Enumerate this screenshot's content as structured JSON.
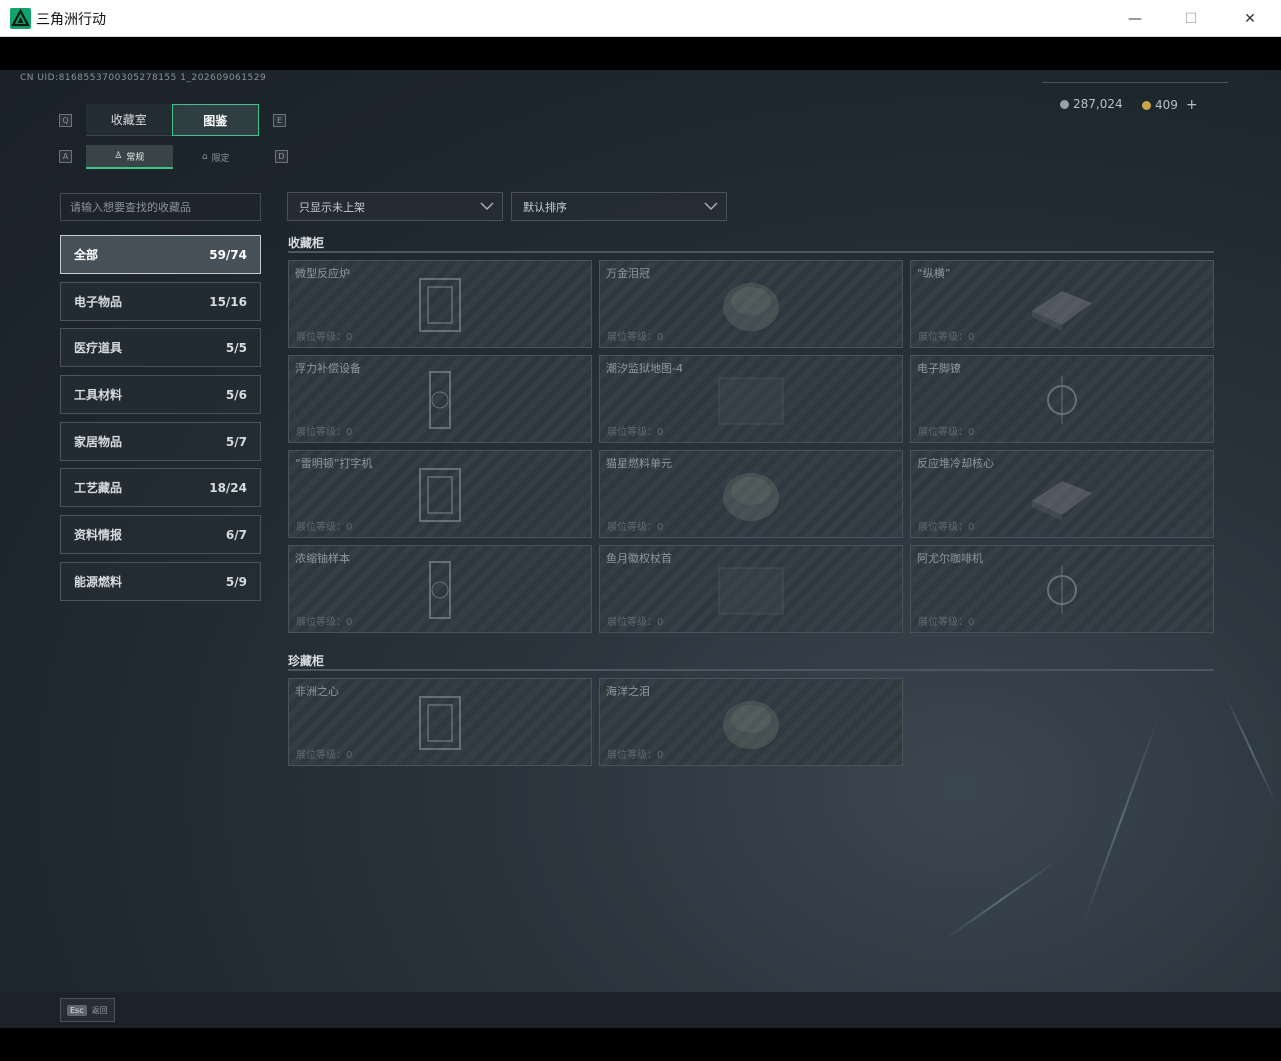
{
  "window": {
    "title": "三角洲行动",
    "minimize": "—",
    "maximize": "☐",
    "close": "✕"
  },
  "uid": "CN UID:8168553700305278155 1_202609061529",
  "currency": [
    {
      "value": "287,024",
      "color": "#9aa0a6"
    },
    {
      "value": "409",
      "color": "#c9a74a",
      "plus": "+"
    }
  ],
  "key_hints": {
    "q": "Q",
    "e": "E",
    "a": "A",
    "d": "D"
  },
  "main_tabs": [
    {
      "label": "收藏室",
      "active": false
    },
    {
      "label": "图鉴",
      "active": true
    }
  ],
  "sub_tabs": [
    {
      "label": "常规",
      "icon": "collection-icon",
      "active": true
    },
    {
      "label": "限定",
      "icon": "limited-icon",
      "active": false
    }
  ],
  "search": {
    "placeholder": "请输入想要查找的收藏品"
  },
  "categories": [
    {
      "label": "全部",
      "count": "59/74",
      "active": true
    },
    {
      "label": "电子物品",
      "count": "15/16"
    },
    {
      "label": "医疗道具",
      "count": "5/5"
    },
    {
      "label": "工具材料",
      "count": "5/6"
    },
    {
      "label": "家居物品",
      "count": "5/7"
    },
    {
      "label": "工艺藏品",
      "count": "18/24"
    },
    {
      "label": "资料情报",
      "count": "6/7"
    },
    {
      "label": "能源燃料",
      "count": "5/9"
    }
  ],
  "filters": {
    "display": "只显示未上架",
    "sort": "默认排序"
  },
  "sections": {
    "cabinet": {
      "title": "收藏柜",
      "items": [
        {
          "name": "微型反应炉",
          "level": "展位等级：0",
          "icon": "reactor-icon"
        },
        {
          "name": "万金泪冠",
          "level": "展位等级：0",
          "icon": "crown-icon"
        },
        {
          "name": "“纵横”",
          "level": "展位等级：0",
          "icon": "board-icon"
        },
        {
          "name": "浮力补偿设备",
          "level": "展位等级：0",
          "icon": "buoyancy-icon"
        },
        {
          "name": "潮汐监狱地图-4",
          "level": "展位等级：0",
          "icon": "map-icon"
        },
        {
          "name": "电子脚镣",
          "level": "展位等级：0",
          "icon": "shackle-icon"
        },
        {
          "name": "“雷明顿”打字机",
          "level": "展位等级：0",
          "icon": "typewriter-icon"
        },
        {
          "name": "猫星燃料单元",
          "level": "展位等级：0",
          "icon": "fuel-cell-icon"
        },
        {
          "name": "反应堆冷却核心",
          "level": "展位等级：0",
          "icon": "core-icon"
        },
        {
          "name": "浓缩铀样本",
          "level": "展位等级：0",
          "icon": "uranium-icon"
        },
        {
          "name": "鱼月徽权杖首",
          "level": "展位等级：0",
          "icon": "scepter-icon"
        },
        {
          "name": "阿尤尔咖啡机",
          "level": "展位等级：0",
          "icon": "coffee-machine-icon"
        }
      ]
    },
    "treasure": {
      "title": "珍藏柜",
      "items": [
        {
          "name": "非洲之心",
          "level": "展位等级：0",
          "icon": "gem-icon"
        },
        {
          "name": "海洋之泪",
          "level": "展位等级：0",
          "icon": "pearl-icon"
        }
      ]
    }
  },
  "footer": {
    "esc_key": "Esc",
    "esc_label": "返回"
  },
  "colors": {
    "accent": "#3ec28c",
    "bg": "#222a32",
    "card_text": "#8f989e"
  }
}
